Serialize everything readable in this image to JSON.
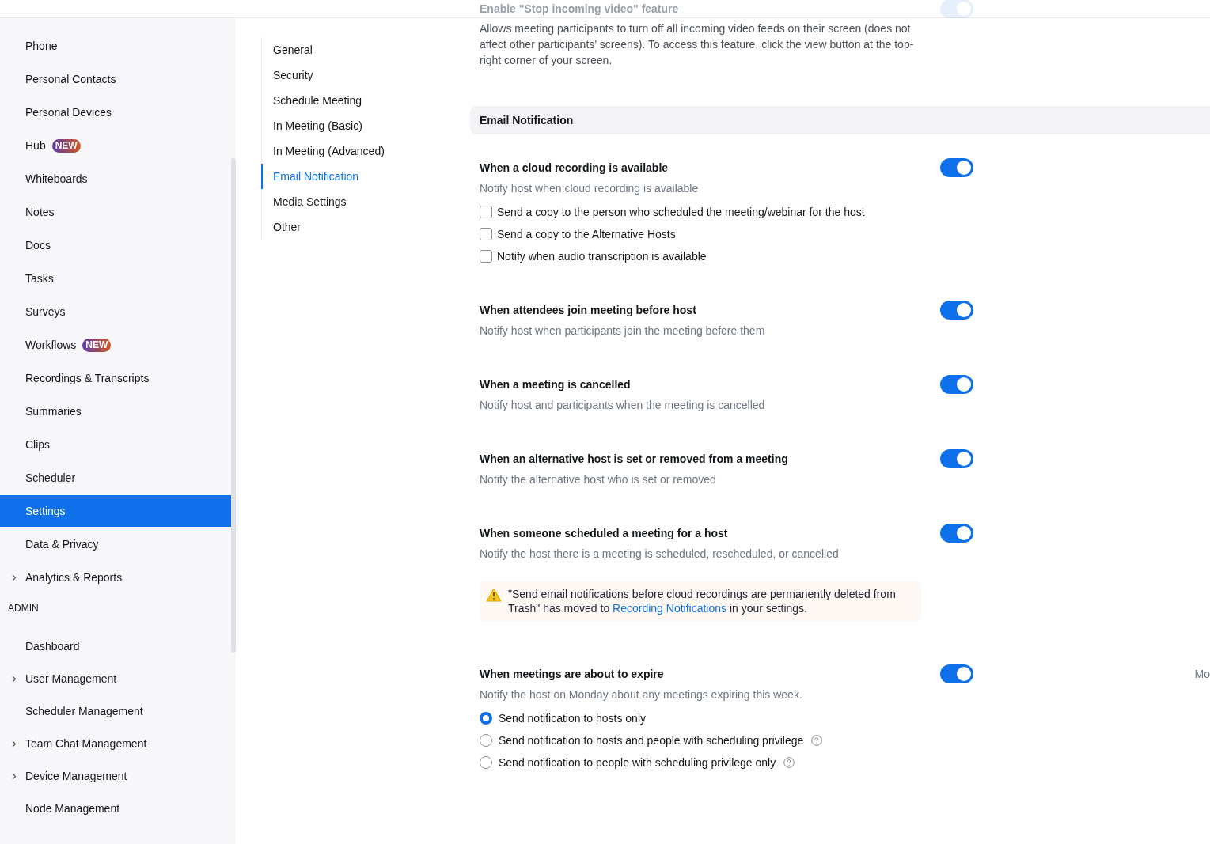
{
  "top_setting": {
    "title": "Enable \"Stop incoming video\" feature",
    "on": true,
    "description": "Allows meeting participants to turn off all incoming video feeds on their screen (does not affect other participants’ screens). To access this feature, click the view button at the top-right corner of your screen."
  },
  "sidebar": {
    "items": [
      {
        "label": "Phone",
        "selected": false
      },
      {
        "label": "Personal Contacts",
        "selected": false
      },
      {
        "label": "Personal Devices",
        "selected": false
      },
      {
        "label": "Hub",
        "badge": "NEW",
        "selected": false
      },
      {
        "label": "Whiteboards",
        "selected": false
      },
      {
        "label": "Notes",
        "selected": false
      },
      {
        "label": "Docs",
        "selected": false
      },
      {
        "label": "Tasks",
        "selected": false
      },
      {
        "label": "Surveys",
        "selected": false
      },
      {
        "label": "Workflows",
        "badge": "NEW",
        "selected": false
      },
      {
        "label": "Recordings & Transcripts",
        "selected": false
      },
      {
        "label": "Summaries",
        "selected": false
      },
      {
        "label": "Clips",
        "selected": false
      },
      {
        "label": "Scheduler",
        "selected": false
      },
      {
        "label": "Settings",
        "selected": true
      },
      {
        "label": "Data & Privacy",
        "selected": false
      },
      {
        "label": "Analytics & Reports",
        "expandable": true,
        "selected": false
      }
    ],
    "admin_heading": "ADMIN",
    "admin_items": [
      {
        "label": "Dashboard",
        "selected": false
      },
      {
        "label": "User Management",
        "expandable": true,
        "selected": false
      },
      {
        "label": "Scheduler Management",
        "selected": false
      },
      {
        "label": "Team Chat Management",
        "expandable": true,
        "selected": false
      },
      {
        "label": "Device Management",
        "expandable": true,
        "selected": false
      },
      {
        "label": "Node Management",
        "selected": false
      }
    ]
  },
  "section_nav": [
    {
      "label": "General",
      "selected": false
    },
    {
      "label": "Security",
      "selected": false
    },
    {
      "label": "Schedule Meeting",
      "selected": false
    },
    {
      "label": "In Meeting (Basic)",
      "selected": false
    },
    {
      "label": "In Meeting (Advanced)",
      "selected": false
    },
    {
      "label": "Email Notification",
      "selected": true
    },
    {
      "label": "Media Settings",
      "selected": false
    },
    {
      "label": "Other",
      "selected": false
    }
  ],
  "section_title": "Email Notification",
  "settings": [
    {
      "kind": "toggle",
      "title": "When a cloud recording is available",
      "description": "Notify host when cloud recording is available",
      "on": true,
      "options": [
        {
          "kind": "checkbox",
          "label": "Send a copy to the person who scheduled the meeting/webinar for the host",
          "checked": false
        },
        {
          "kind": "checkbox",
          "label": "Send a copy to the Alternative Hosts",
          "checked": false
        },
        {
          "kind": "checkbox",
          "label": "Notify when audio transcription is available",
          "checked": false
        }
      ]
    },
    {
      "kind": "toggle",
      "title": "When attendees join meeting before host",
      "description": "Notify host when participants join the meeting before them",
      "on": true
    },
    {
      "kind": "toggle",
      "title": "When a meeting is cancelled",
      "description": "Notify host and participants when the meeting is cancelled",
      "on": true
    },
    {
      "kind": "toggle",
      "title": "When an alternative host is set or removed from a meeting",
      "description": "Notify the alternative host who is set or removed",
      "on": true
    },
    {
      "kind": "toggle",
      "title": "When someone scheduled a meeting for a host",
      "description": "Notify the host there is a meeting is scheduled, rescheduled, or cancelled",
      "on": true
    },
    {
      "kind": "notice",
      "text_before": "\"Send email notifications before cloud recordings are permanently deleted from Trash\" has moved to",
      "link": "Recording Notifications",
      "text_after": "in your settings."
    },
    {
      "kind": "toggle",
      "title": "When meetings are about to expire",
      "description": "Notify the host on Monday about any meetings expiring this week.",
      "on": true,
      "side_text": "Mo",
      "options": [
        {
          "kind": "radio",
          "label": "Send notification to hosts only",
          "selected": true
        },
        {
          "kind": "radio",
          "label": "Send notification to hosts and people with scheduling privilege",
          "selected": false,
          "help": true
        },
        {
          "kind": "radio",
          "label": "Send notification to people with scheduling privilege only",
          "selected": false,
          "help": true
        }
      ]
    }
  ]
}
